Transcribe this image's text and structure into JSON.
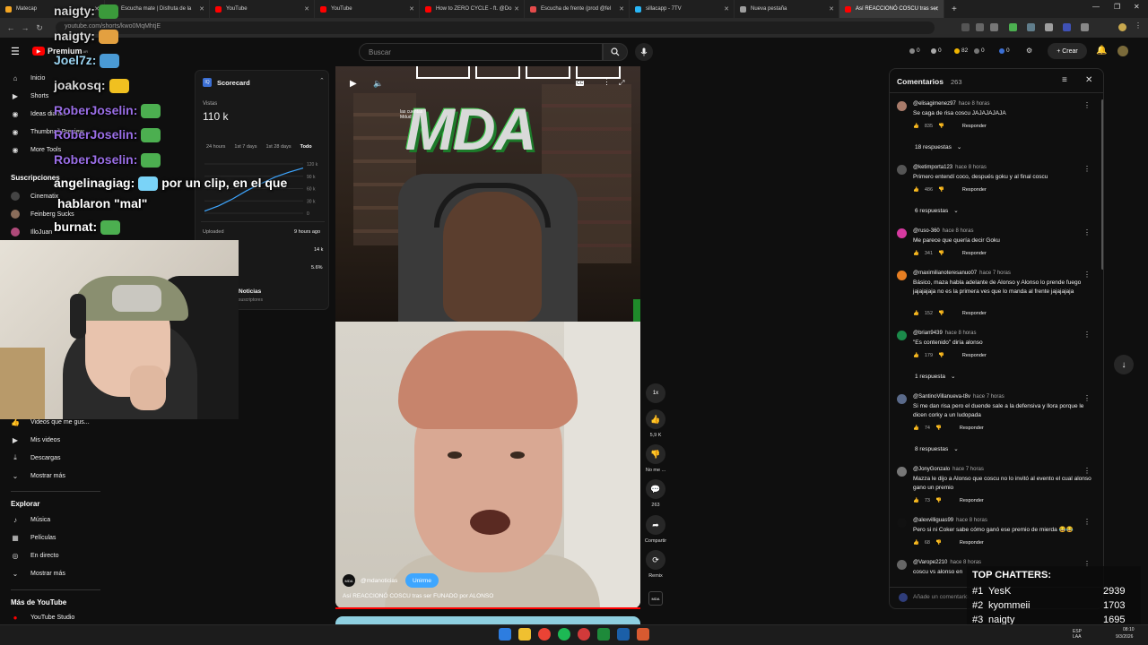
{
  "browser": {
    "tabs": [
      {
        "label": "Matecap",
        "color": "#f5a623"
      },
      {
        "label": "Escucha mate | Disfruta de la",
        "color": "#e54b4b"
      },
      {
        "label": "YouTube",
        "color": "#ff0000"
      },
      {
        "label": "YouTube",
        "color": "#ff0000"
      },
      {
        "label": "How to ZERO CYCLE - ft. @Do",
        "color": "#ff0000"
      },
      {
        "label": "Escucha de frente (prod @fel",
        "color": "#e54b4b"
      },
      {
        "label": "sillacapp - 7TV",
        "color": "#29b6f6"
      },
      {
        "label": "Nueva pestaña",
        "color": "#9e9e9e"
      },
      {
        "label": "Así REACCIONÓ COSCU tras ser",
        "color": "#ff0000"
      }
    ],
    "new_tab": "+",
    "url": "youtube.com/shorts/kwo0MqMhtjE"
  },
  "youtube": {
    "logo_text": "Premium",
    "logo_sub": "AR",
    "search_placeholder": "Buscar",
    "crear_label": "+ Crear",
    "counters": [
      "0",
      "0",
      "82",
      "0",
      "0"
    ],
    "sidebar": {
      "items": [
        {
          "label": "Inicio",
          "icon": "home-icon"
        },
        {
          "label": "Shorts",
          "icon": "shorts-icon"
        },
        {
          "label": "Ideas diarias",
          "icon": "bulb-icon"
        },
        {
          "label": "Thumbnail Preview",
          "icon": "image-icon"
        },
        {
          "label": "More Tools",
          "icon": "tools-icon"
        }
      ],
      "subs_title": "Suscripciones",
      "subs": [
        {
          "label": "Cinematix",
          "color": "#444"
        },
        {
          "label": "Feinberg Sucks",
          "color": "#8a6d5a"
        },
        {
          "label": "IlloJuan",
          "color": "#b04a7a"
        }
      ],
      "you_items": [
        {
          "label": "Videos que me gus...",
          "icon": "like-icon"
        },
        {
          "label": "Mis videos",
          "icon": "video-icon"
        },
        {
          "label": "Descargas",
          "icon": "download-icon"
        },
        {
          "label": "Mostrar más",
          "icon": "chevron-down-icon"
        }
      ],
      "explore_title": "Explorar",
      "explore_items": [
        {
          "label": "Música",
          "icon": "music-icon"
        },
        {
          "label": "Películas",
          "icon": "film-icon"
        },
        {
          "label": "En directo",
          "icon": "live-icon"
        },
        {
          "label": "Mostrar más",
          "icon": "chevron-down-icon"
        }
      ],
      "more_title": "Más de YouTube",
      "more_items": [
        {
          "label": "YouTube Studio",
          "icon": "studio-icon"
        }
      ]
    },
    "scorecard": {
      "title": "Scorecard",
      "views_label": "Vistas",
      "views_value": "110 k",
      "ranges": [
        "24 hours",
        "1st 7 days",
        "1st 28 days",
        "Todo"
      ],
      "y_ticks": [
        "120 k",
        "90 k",
        "60 k",
        "30 k",
        "0"
      ],
      "uploaded_label": "Uploaded",
      "uploaded_value": "9 hours ago",
      "row2_value": "14 k",
      "row3_value": "5.6%",
      "channel_label": "Noticias",
      "channel_sub": "suscriptores",
      "chart_points": [
        5,
        18,
        35,
        55,
        72,
        88,
        100,
        110
      ]
    },
    "video": {
      "overlay_text": "MDA",
      "overlay_small": "las cuentas\nMdud",
      "channel": "@mdanoticias",
      "join_label": "Unirme",
      "caption": "Así REACCIONÓ COSCU tras ser FUNADO por ALONSO",
      "speed": "1x",
      "likes": "5,9 K",
      "dislike_label": "No me ...",
      "comments_count": "263",
      "share_label": "Compartir",
      "remix_label": "Remix",
      "cc": "CC"
    },
    "comments": {
      "title": "Comentarios",
      "count": "263",
      "add_placeholder": "Añade un comentario...",
      "items": [
        {
          "author": "@elisagimenez97",
          "time": "hace 8 horas",
          "text": "Se caga de risa coscu JAJAJAJAJA",
          "likes": "835",
          "replies": "18 respuestas",
          "color": "#a87b6a"
        },
        {
          "author": "@ketimporta123",
          "time": "hace 8 horas",
          "text": "Primero entendí coco, después goku y al final coscu",
          "likes": "486",
          "replies": "6 respuestas",
          "color": "#555"
        },
        {
          "author": "@ruso-360",
          "time": "hace 8 horas",
          "text": "Me parece que quería decir Goku",
          "likes": "341",
          "replies": "",
          "color": "#d63aa0"
        },
        {
          "author": "@maximilianoteresanuo07",
          "time": "hace 7 horas",
          "text": "Básico, maza habla adelante de Alonso y Alonso lo prende fuego jajajajaja no es la primera ves que lo manda al frente jajajajaja",
          "likes": "152",
          "replies": "",
          "color": "#e67e22"
        },
        {
          "author": "@brian9439",
          "time": "hace 8 horas",
          "text": "\"Es contenido\" diría alonso",
          "likes": "179",
          "replies": "1 respuesta",
          "color": "#1b8a4a"
        },
        {
          "author": "@SantinoVillanueva-t8v",
          "time": "hace 7 horas",
          "text": "Si me dan risa pero el duende sale a la defensiva y llora porque le dicen corky a un ludopada",
          "likes": "74",
          "replies": "8 respuestas",
          "color": "#5a6a8a"
        },
        {
          "author": "@JonyGonzalo",
          "time": "hace 7 horas",
          "text": "Mazza le dijo a Alonso que coscu no lo invitó al evento el cual alonso gano un premio",
          "likes": "73",
          "replies": "",
          "color": "#777"
        },
        {
          "author": "@alexvilliguas99",
          "time": "hace 8 horas",
          "text": "Pero si ni Coker sabe cómo ganó ese premio de mierda 😂😂",
          "likes": "68",
          "replies": "",
          "color": "#111"
        },
        {
          "author": "@Varope2210",
          "time": "hace 8 horas",
          "text": "coscu vs alonso en",
          "likes": "",
          "replies": "",
          "color": "#666"
        }
      ],
      "reply_label": "Responder"
    }
  },
  "stream": {
    "chat": [
      {
        "user": "naigty:",
        "color": "#d6d6d6",
        "msg": ""
      },
      {
        "user": "naigty:",
        "color": "#d6d6d6",
        "msg": ""
      },
      {
        "user": "Joel7z:",
        "color": "#9ad3f0",
        "msg": ""
      },
      {
        "user": "joakosq:",
        "color": "#d6d6d6",
        "msg": ""
      },
      {
        "user": "RoberJoselin:",
        "color": "#9a6ee6",
        "msg": ""
      },
      {
        "user": "RoberJoselin:",
        "color": "#9a6ee6",
        "msg": ""
      },
      {
        "user": "RoberJoselin:",
        "color": "#9a6ee6",
        "msg": ""
      },
      {
        "user": "angelinagiag:",
        "color": "#ffffff",
        "msg": "por un clip, en el que"
      },
      {
        "user": "",
        "color": "#ffffff",
        "msg": "hablaron \"mal\""
      },
      {
        "user": "burnat:",
        "color": "#ffffff",
        "msg": ""
      }
    ],
    "top_chatters_title": "TOP CHATTERS:",
    "top_chatters": [
      {
        "rank": "#1",
        "name": "YesK",
        "count": "2939"
      },
      {
        "rank": "#2",
        "name": "kyommeii",
        "count": "1703"
      },
      {
        "rank": "#3",
        "name": "naigty",
        "count": "1695"
      }
    ]
  },
  "taskbar": {
    "lang": "ESP\nLAA",
    "time": "08:10",
    "date": "9/3/2026"
  }
}
